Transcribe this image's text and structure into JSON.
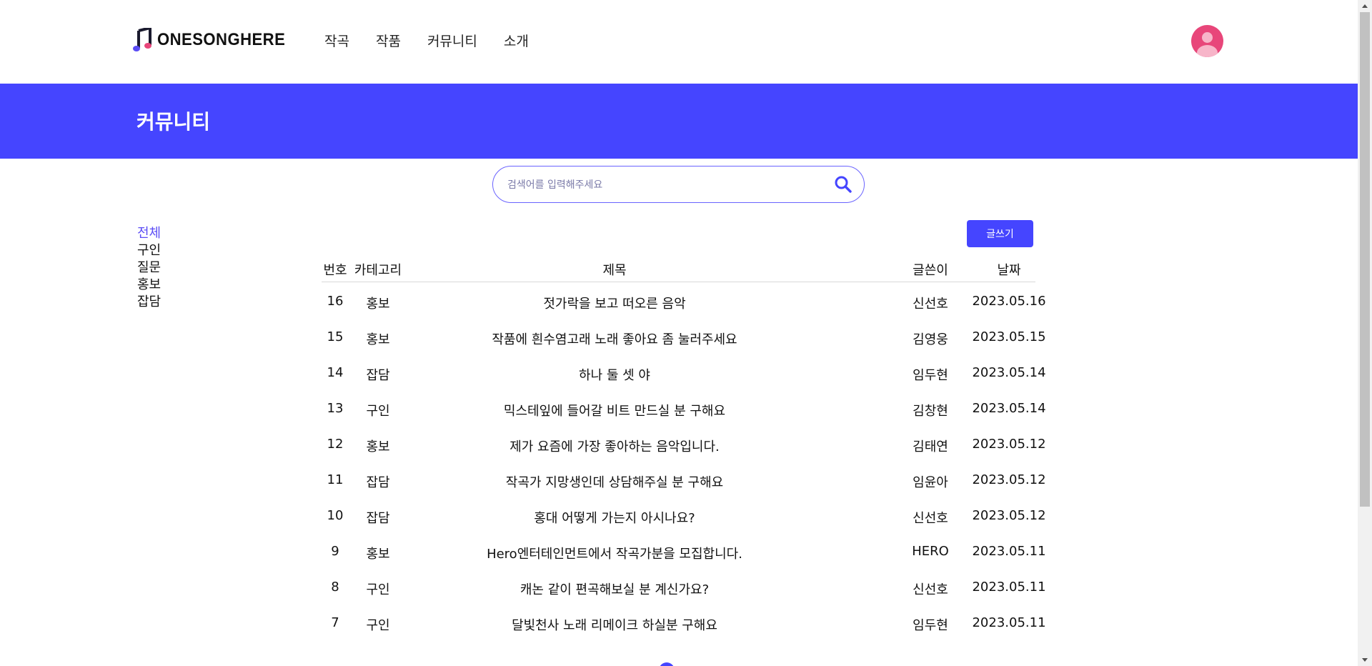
{
  "header": {
    "logo_text": "ONESONGHERE",
    "nav": [
      "작곡",
      "작품",
      "커뮤니티",
      "소개"
    ]
  },
  "banner": {
    "title": "커뮤니티"
  },
  "search": {
    "placeholder": "검색어를 입력해주세요",
    "value": ""
  },
  "sidebar": {
    "items": [
      "전체",
      "구인",
      "질문",
      "홍보",
      "잡담"
    ],
    "active": "전체"
  },
  "toolbar": {
    "write_label": "글쓰기"
  },
  "table": {
    "headers": {
      "no": "번호",
      "category": "카테고리",
      "title": "제목",
      "author": "글쓴이",
      "date": "날짜"
    },
    "rows": [
      {
        "no": "16",
        "category": "홍보",
        "title": "젓가락을 보고 떠오른 음악",
        "author": "신선호",
        "date": "2023.05.16"
      },
      {
        "no": "15",
        "category": "홍보",
        "title": "작품에 흰수염고래 노래 좋아요 좀 눌러주세요",
        "author": "김영웅",
        "date": "2023.05.15"
      },
      {
        "no": "14",
        "category": "잡담",
        "title": "하나 둘 셋 야",
        "author": "임두현",
        "date": "2023.05.14"
      },
      {
        "no": "13",
        "category": "구인",
        "title": "믹스테잎에 들어갈 비트 만드실 분 구해요",
        "author": "김창현",
        "date": "2023.05.14"
      },
      {
        "no": "12",
        "category": "홍보",
        "title": "제가 요즘에 가장 좋아하는 음악입니다.",
        "author": "김태연",
        "date": "2023.05.12"
      },
      {
        "no": "11",
        "category": "잡담",
        "title": "작곡가 지망생인데 상담해주실 분 구해요",
        "author": "임윤아",
        "date": "2023.05.12"
      },
      {
        "no": "10",
        "category": "잡담",
        "title": "홍대 어떻게 가는지 아시나요?",
        "author": "신선호",
        "date": "2023.05.12"
      },
      {
        "no": "9",
        "category": "홍보",
        "title": "Hero엔터테인먼트에서 작곡가분을 모집합니다.",
        "author": "HERO",
        "date": "2023.05.11"
      },
      {
        "no": "8",
        "category": "구인",
        "title": "캐논 같이 편곡해보실 분 계신가요?",
        "author": "신선호",
        "date": "2023.05.11"
      },
      {
        "no": "7",
        "category": "구인",
        "title": "달빛천사 노래 리메이크 하실분 구해요",
        "author": "임두현",
        "date": "2023.05.11"
      }
    ]
  },
  "icons": {
    "logo": "music-note-icon",
    "search": "search-icon",
    "avatar": "user-avatar-icon"
  },
  "colors": {
    "accent": "#4545ff",
    "sidebar_active": "#5b4cf5",
    "avatar_bg": "#e8467a",
    "avatar_fg": "#f7b5c9"
  }
}
